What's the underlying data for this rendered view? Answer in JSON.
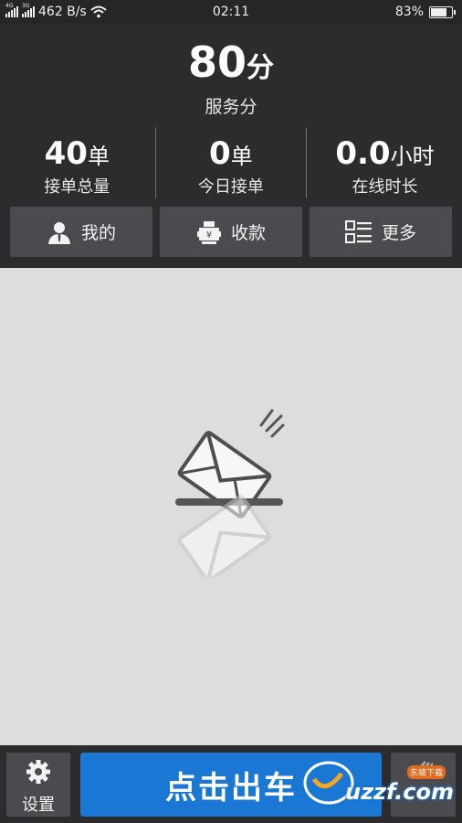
{
  "status_bar": {
    "network_1": "4G",
    "network_2": "3G",
    "speed": "462 B/s",
    "time": "02:11",
    "battery_percent": "83%",
    "battery_level": 0.83
  },
  "header": {
    "score_value": "80",
    "score_unit": "分",
    "score_label": "服务分",
    "stats": [
      {
        "value": "40",
        "unit": "单",
        "label": "接单总量"
      },
      {
        "value": "0",
        "unit": "单",
        "label": "今日接单"
      },
      {
        "value": "0.0",
        "unit": "小时",
        "label": "在线时长"
      }
    ]
  },
  "actions": {
    "mine": {
      "label": "我的",
      "icon": "person-icon"
    },
    "collect": {
      "label": "收款",
      "icon": "cash-register-icon"
    },
    "more": {
      "label": "更多",
      "icon": "list-grid-icon"
    }
  },
  "main": {
    "empty_icon": "envelope-icon"
  },
  "bottom_bar": {
    "settings_label": "设置",
    "settings_icon": "gear-icon",
    "go_label": "点击出车",
    "watermark_text": "uzzf.com",
    "watermark_sub": "东坡下载"
  },
  "colors": {
    "header_bg": "#2c2c2e",
    "button_bg": "#4b4b4f",
    "main_bg": "#dcdddd",
    "accent_blue": "#1a77d4"
  }
}
